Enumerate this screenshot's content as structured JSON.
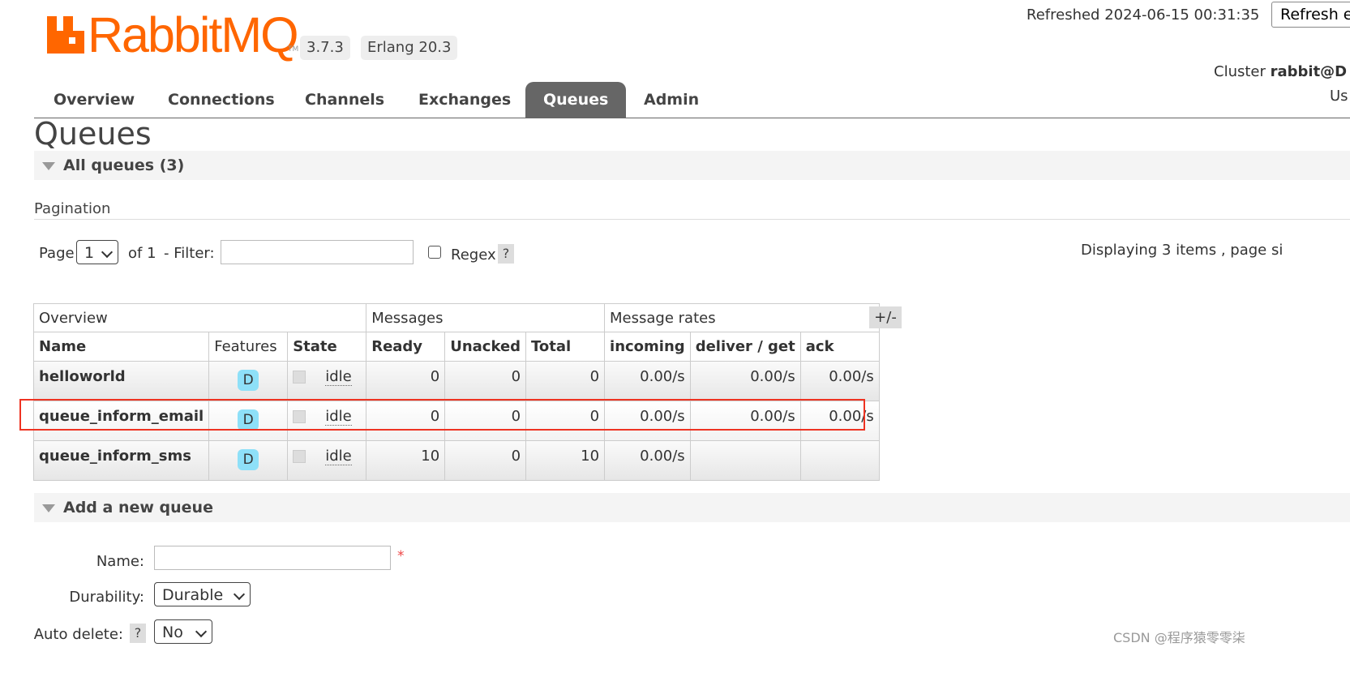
{
  "header": {
    "logo_text": "RabbitMQ",
    "logo_tm": "TM",
    "version": "3.7.3",
    "erlang": "Erlang 20.3",
    "refreshed": "Refreshed 2024-06-15 00:31:35",
    "refresh_button": "Refresh e",
    "cluster_label": "Cluster ",
    "cluster_name": "rabbit@D",
    "user_label": "Us"
  },
  "tabs": [
    "Overview",
    "Connections",
    "Channels",
    "Exchanges",
    "Queues",
    "Admin"
  ],
  "active_tab": "Queues",
  "page_title": "Queues",
  "all_queues": "All queues (3)",
  "pagination": {
    "label": "Pagination",
    "page_label": "Page",
    "page_value": "1",
    "of_label": "of 1",
    "filter_label": "- Filter:",
    "regex_label": "Regex",
    "help": "?",
    "displaying": "Displaying 3 items , page si"
  },
  "table": {
    "groups": [
      "Overview",
      "Messages",
      "Message rates"
    ],
    "columns": [
      "Name",
      "Features",
      "State",
      "Ready",
      "Unacked",
      "Total",
      "incoming",
      "deliver / get",
      "ack"
    ],
    "toggle": "+/-",
    "rows": [
      {
        "name": "helloworld",
        "feature": "D",
        "state": "idle",
        "ready": "0",
        "unacked": "0",
        "total": "0",
        "incoming": "0.00/s",
        "deliver": "0.00/s",
        "ack": "0.00/s"
      },
      {
        "name": "queue_inform_email",
        "feature": "D",
        "state": "idle",
        "ready": "0",
        "unacked": "0",
        "total": "0",
        "incoming": "0.00/s",
        "deliver": "0.00/s",
        "ack": "0.00/s"
      },
      {
        "name": "queue_inform_sms",
        "feature": "D",
        "state": "idle",
        "ready": "10",
        "unacked": "0",
        "total": "10",
        "incoming": "0.00/s",
        "deliver": "",
        "ack": ""
      }
    ]
  },
  "add_queue": {
    "title": "Add a new queue",
    "name_label": "Name:",
    "required": "*",
    "durability_label": "Durability:",
    "durability_value": "Durable",
    "auto_delete_label": "Auto delete:",
    "auto_delete_help": "?",
    "auto_delete_value": "No"
  },
  "watermark": "CSDN @程序猿零零柒",
  "colors": {
    "brand": "#ff6600",
    "active_tab": "#666666",
    "feature_badge": "#8ee0f8",
    "highlight": "#e33322"
  }
}
